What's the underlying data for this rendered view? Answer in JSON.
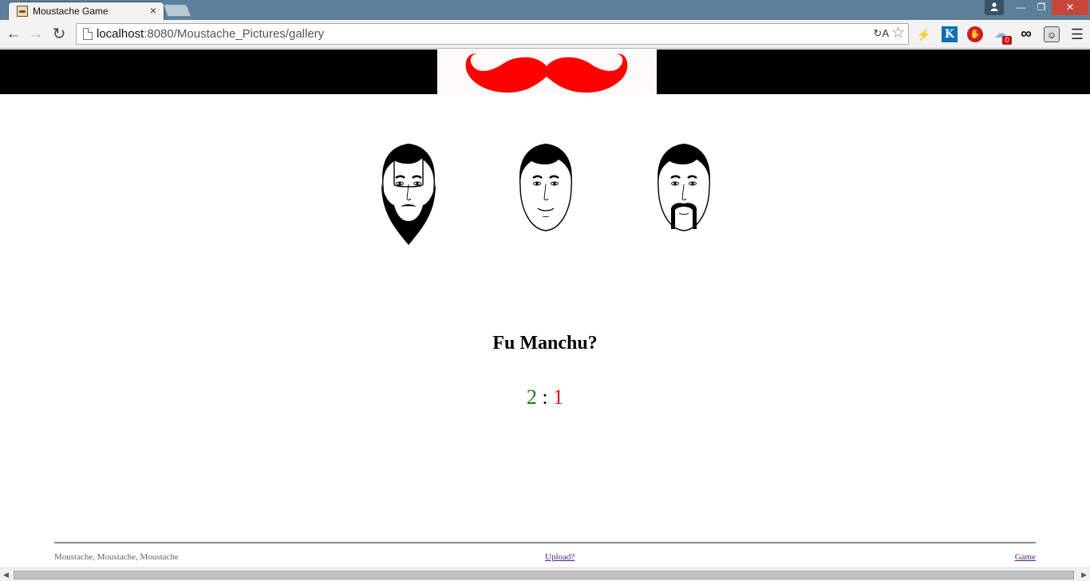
{
  "browser": {
    "tab_title": "Moustache Game",
    "tab_close": "×",
    "url_host": "localhost",
    "url_rest": ":8080/Moustache_Pictures/gallery",
    "window_min": "—",
    "window_max": "❐",
    "window_close": "✕",
    "extension_badge": "0"
  },
  "game": {
    "faces": [
      {
        "style": "full beard"
      },
      {
        "style": "clean shaven"
      },
      {
        "style": "fu manchu"
      }
    ],
    "question": "Fu Manchu?",
    "score": {
      "correct": "2",
      "separator": ":",
      "wrong": "1"
    },
    "colors": {
      "correct": "#1a7a1a",
      "wrong": "#e01010",
      "moustache_logo": "#ff0000"
    }
  },
  "footer": {
    "left_text": "Moustache, Moustache, Moustache",
    "upload_link": "Upload?",
    "game_link": "Game"
  }
}
